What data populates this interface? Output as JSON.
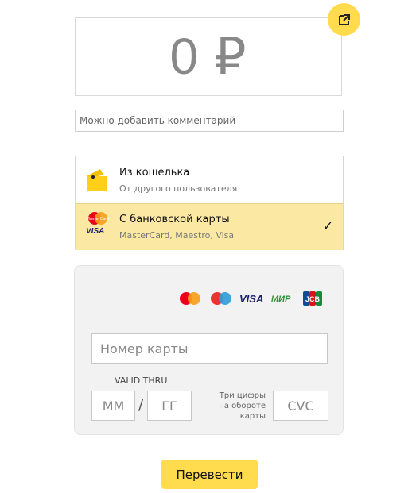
{
  "amount": {
    "text": "0 ₽"
  },
  "comment": {
    "placeholder": "Можно добавить комментарий"
  },
  "sources": [
    {
      "title": "Из кошелька",
      "subtitle": "От другого пользователя"
    },
    {
      "title": "С банковской карты",
      "subtitle": "MasterCard, Maestro, Visa",
      "selected": true,
      "badge_top": "MasterCard",
      "badge_bottom": "VISA"
    }
  ],
  "card_form": {
    "logos": {
      "visa": "VISA",
      "mir": "МИР",
      "jcb": "JCB"
    },
    "card_number_placeholder": "Номер карты",
    "valid_thru_label": "VALID THRU",
    "month_placeholder": "ММ",
    "year_placeholder": "ГГ",
    "separator": "/",
    "cvc_hint": "Три цифры на обороте карты",
    "cvc_placeholder": "CVC"
  },
  "check_mark": "✓",
  "submit_label": "Перевести",
  "colors": {
    "accent_yellow": "#ffdb4d",
    "selected_bg": "#fbe9a3",
    "form_bg": "#f2f2f2"
  }
}
